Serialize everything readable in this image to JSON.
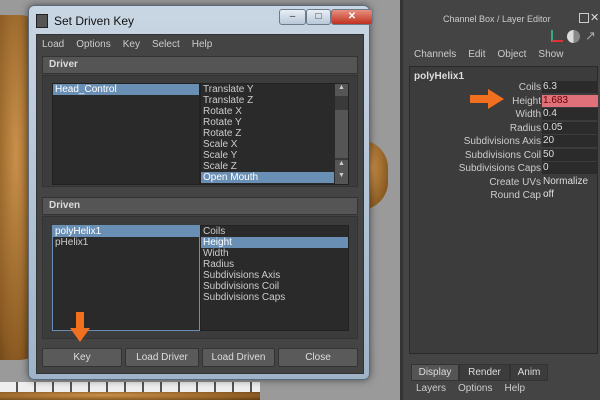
{
  "dialog": {
    "title": "Set Driven Key",
    "menu": [
      "Load",
      "Options",
      "Key",
      "Select",
      "Help"
    ],
    "driver": {
      "header": "Driver",
      "objects": [
        "Head_Control"
      ],
      "selected_object": 0,
      "attributes": [
        "Translate Y",
        "Translate Z",
        "Rotate X",
        "Rotate Y",
        "Rotate Z",
        "Scale X",
        "Scale Y",
        "Scale Z",
        "Open Mouth"
      ],
      "selected_attribute": 8
    },
    "driven": {
      "header": "Driven",
      "objects": [
        "polyHelix1",
        "pHelix1"
      ],
      "selected_object": 0,
      "attributes": [
        "Coils",
        "Height",
        "Width",
        "Radius",
        "Subdivisions Axis",
        "Subdivisions Coil",
        "Subdivisions Caps"
      ],
      "selected_attribute": 1
    },
    "buttons": {
      "key": "Key",
      "load_driver": "Load Driver",
      "load_driven": "Load Driven",
      "close": "Close"
    }
  },
  "channel_box": {
    "title": "Channel Box / Layer Editor",
    "menu": [
      "Channels",
      "Edit",
      "Object",
      "Show"
    ],
    "node": "polyHelix1",
    "channels": [
      {
        "label": "Coils",
        "value": "6.3"
      },
      {
        "label": "Height",
        "value": "1.683",
        "highlight": true
      },
      {
        "label": "Width",
        "value": "0.4"
      },
      {
        "label": "Radius",
        "value": "0.05"
      },
      {
        "label": "Subdivisions Axis",
        "value": "20"
      },
      {
        "label": "Subdivisions Coil",
        "value": "50"
      },
      {
        "label": "Subdivisions Caps",
        "value": "0"
      }
    ],
    "extra": [
      {
        "label": "Create UVs",
        "value": "Normalize ..."
      },
      {
        "label": "Round Cap",
        "value": "off"
      }
    ],
    "tabs": [
      "Display",
      "Render",
      "Anim"
    ],
    "active_tab": "Display",
    "layer_menu": [
      "Layers",
      "Options",
      "Help"
    ]
  },
  "colors": {
    "accent_arrow": "#f07020",
    "selection": "#6a8fb5",
    "highlight_channel": "#e0707a"
  }
}
